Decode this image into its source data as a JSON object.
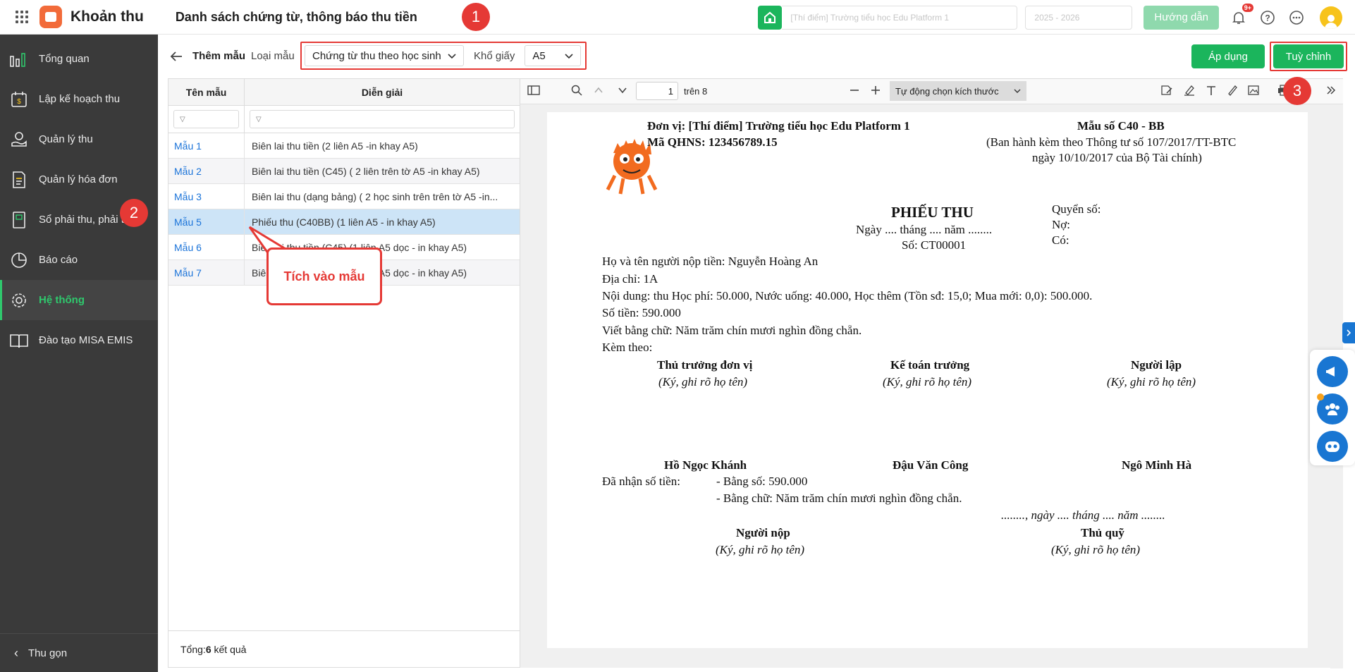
{
  "app": {
    "name": "Khoản thu",
    "page_title": "Danh sách chứng từ, thông báo thu tiền"
  },
  "topbar": {
    "guide_label": "Hướng dẫn",
    "notification_badge": "9+",
    "school_placeholder": "[Thí điểm] Trường tiểu học Edu Platform 1",
    "year_placeholder": "2025 - 2026"
  },
  "sidebar": {
    "items": [
      {
        "label": "Tổng quan",
        "icon": "chart-icon"
      },
      {
        "label": "Lập kế hoạch thu",
        "icon": "calendar-money-icon"
      },
      {
        "label": "Quản lý thu",
        "icon": "hand-money-icon"
      },
      {
        "label": "Quản lý hóa đơn",
        "icon": "invoice-icon"
      },
      {
        "label": "Sổ phải thu, phải trả",
        "icon": "book-icon"
      },
      {
        "label": "Báo cáo",
        "icon": "pie-icon"
      },
      {
        "label": "Hệ thống",
        "icon": "gear-icon"
      },
      {
        "label": "Đào tạo MISA EMIS",
        "icon": "open-book-icon"
      }
    ],
    "active_index": 6,
    "collapse_label": "Thu gọn"
  },
  "toolbar": {
    "add_template": "Thêm mẫu",
    "type_label": "Loại mẫu",
    "type_value": "Chứng từ thu theo học sinh",
    "paper_label": "Khổ giấy",
    "paper_value": "A5",
    "apply_label": "Áp dụng",
    "custom_label": "Tuỳ chỉnh"
  },
  "list": {
    "headers": [
      "Tên mẫu",
      "Diễn giải"
    ],
    "rows": [
      {
        "name": "Mẫu 1",
        "desc": "Biên lai thu tiền (2 liên A5 -in khay A5)"
      },
      {
        "name": "Mẫu 2",
        "desc": "Biên lai thu tiền (C45) ( 2 liên trên tờ A5 -in khay A5)"
      },
      {
        "name": "Mẫu 3",
        "desc": "Biên lai thu (dạng bảng) ( 2 học sinh trên trên tờ A5 -in..."
      },
      {
        "name": "Mẫu 5",
        "desc": "Phiếu thu (C40BB) (1 liên A5 - in khay A5)"
      },
      {
        "name": "Mẫu 6",
        "desc": "Biên lai thu tiền (C45) (1 liên A5 dọc - in khay A5)"
      },
      {
        "name": "Mẫu 7",
        "desc": "Biên lai thu tiền (C45) (1 liên A5 dọc - in khay A5)"
      }
    ],
    "selected_index": 3,
    "footer_prefix": "Tổng: ",
    "footer_count": "6",
    "footer_suffix": " kết quả"
  },
  "annotations": {
    "step1": "1",
    "step2": "2",
    "step3": "3",
    "callout": "Tích vào mẫu"
  },
  "viewer": {
    "page_number": "1",
    "page_total": "trên 8",
    "zoom_label": "Tự động chọn kích thước"
  },
  "receipt": {
    "unit": "Đơn vị: [Thí điểm] Trường tiểu học Edu Platform 1",
    "qhns": "Mã QHNS: 123456789.15",
    "form_no": "Mẫu số C40 - BB",
    "issued_1": "(Ban hành kèm theo Thông tư số 107/2017/TT-BTC",
    "issued_2": "ngày 10/10/2017 của Bộ Tài chính)",
    "title": "PHIẾU THU",
    "date_line": "Ngày .... tháng .... năm ........",
    "number": "Số: CT00001",
    "book": "Quyển số:",
    "debit": "Nợ:",
    "credit": "Có:",
    "payer": "Họ và tên người nộp tiền: Nguyễn Hoàng An",
    "address": "Địa chỉ: 1A",
    "content": "Nội dung: thu Học phí: 50.000, Nước uống: 40.000, Học thêm (Tồn sđ: 15,0; Mua mới: 0,0): 500.000.",
    "amount": "Số tiền: 590.000",
    "in_words": "Viết bằng chữ: Năm trăm chín mươi nghìn đồng chẵn.",
    "attached": "Kèm theo:",
    "sig1_title": "Thủ trưởng đơn vị",
    "sig2_title": "Kế toán trưởng",
    "sig3_title": "Người lập",
    "sig_note": "(Ký, ghi rõ họ tên)",
    "sig1_name": "Hồ Ngọc Khánh",
    "sig2_name": "Đậu Văn Công",
    "sig3_name": "Ngô Minh Hà",
    "received": "Đã nhận số tiền:",
    "received_num": "- Bằng số: 590.000",
    "received_words": "- Bằng chữ: Năm trăm chín mươi nghìn đồng chẵn.",
    "date_line2": "........, ngày .... tháng .... năm ........",
    "payer_sig": "Người nộp",
    "cashier_sig": "Thủ quỹ"
  },
  "colors": {
    "accent": "#1bb55c",
    "sidebar_bg": "#3a3a3a",
    "active": "#2fc86d",
    "highlight": "#e53935",
    "link": "#1a73d9"
  }
}
